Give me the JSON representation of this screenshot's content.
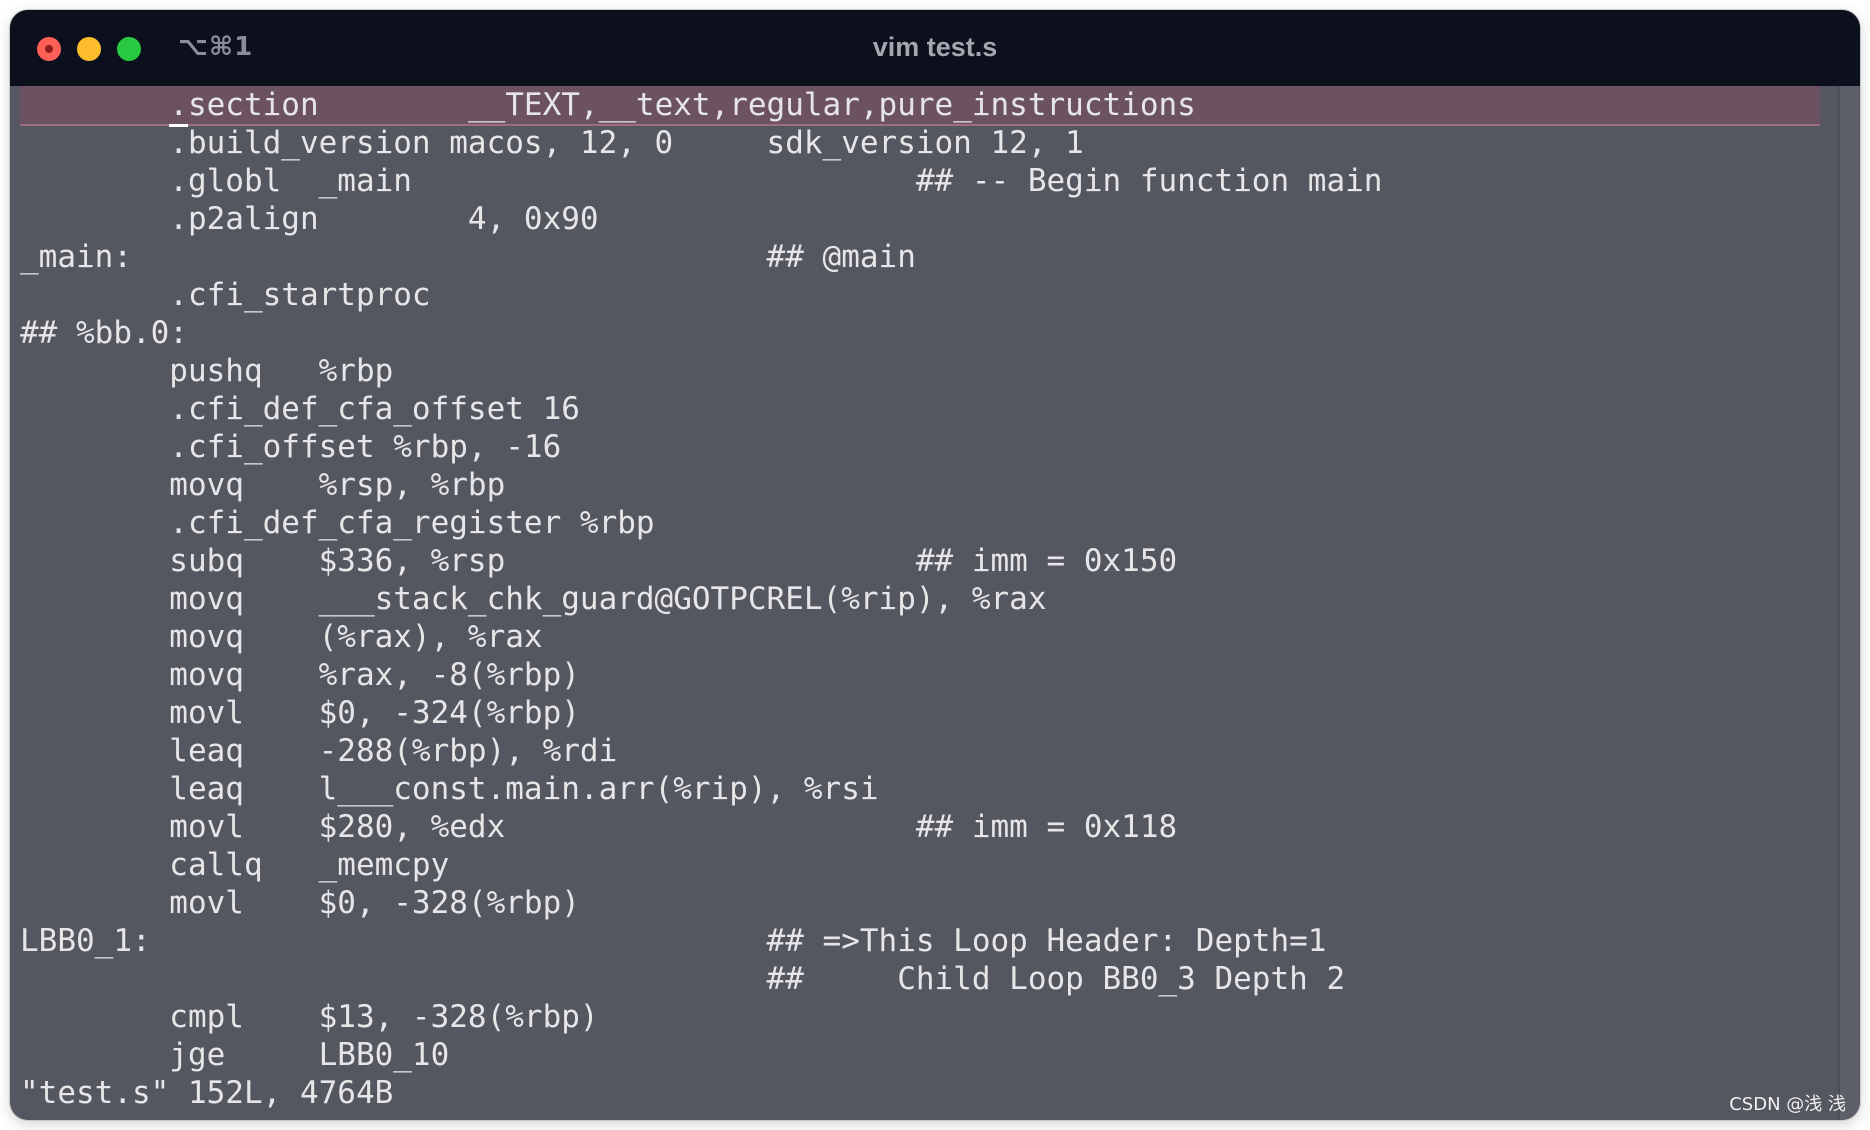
{
  "window": {
    "shortcut": "⌥⌘1",
    "title": "vim test.s"
  },
  "editor": {
    "lines": [
      "        .section        __TEXT,__text,regular,pure_instructions",
      "        .build_version macos, 12, 0     sdk_version 12, 1",
      "        .globl  _main                           ## -- Begin function main",
      "        .p2align        4, 0x90",
      "_main:                                  ## @main",
      "        .cfi_startproc",
      "## %bb.0:",
      "        pushq   %rbp",
      "        .cfi_def_cfa_offset 16",
      "        .cfi_offset %rbp, -16",
      "        movq    %rsp, %rbp",
      "        .cfi_def_cfa_register %rbp",
      "        subq    $336, %rsp                      ## imm = 0x150",
      "        movq    ___stack_chk_guard@GOTPCREL(%rip), %rax",
      "        movq    (%rax), %rax",
      "        movq    %rax, -8(%rbp)",
      "        movl    $0, -324(%rbp)",
      "        leaq    -288(%rbp), %rdi",
      "        leaq    l___const.main.arr(%rip), %rsi",
      "        movl    $280, %edx                      ## imm = 0x118",
      "        callq   _memcpy",
      "        movl    $0, -328(%rbp)",
      "LBB0_1:                                 ## =>This Loop Header: Depth=1",
      "                                        ##     Child Loop BB0_3 Depth 2",
      "        cmpl    $13, -328(%rbp)",
      "        jge     LBB0_10"
    ],
    "status_line": "\"test.s\" 152L, 4764B"
  },
  "watermark": "CSDN @浅 浅",
  "colors": {
    "titlebar": "#0c101c",
    "editor_bg": "#555760",
    "current_line": "#6c5260",
    "text": "#e6e6e9"
  }
}
